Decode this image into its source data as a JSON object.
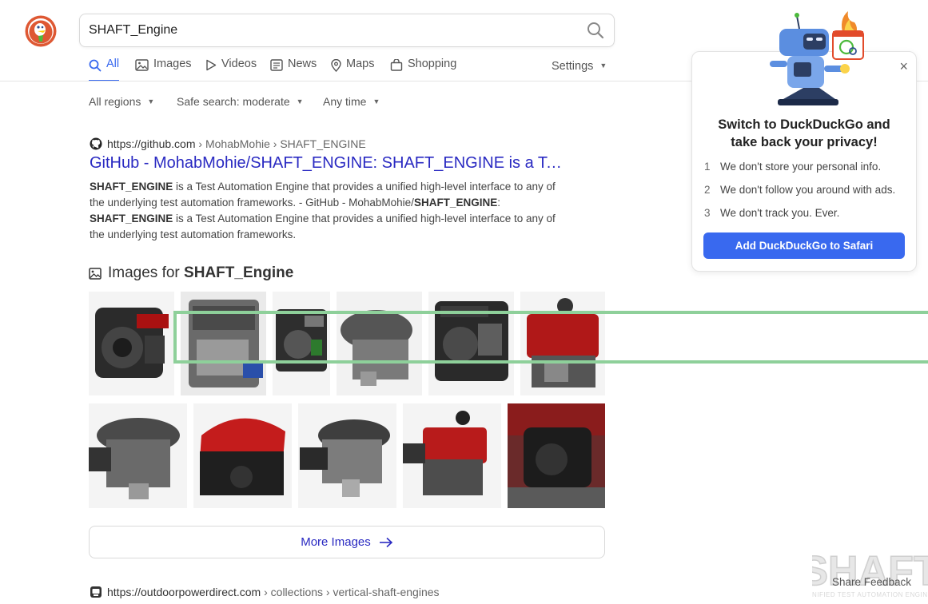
{
  "search": {
    "query": "SHAFT_Engine"
  },
  "nav": {
    "items": [
      {
        "label": "All",
        "icon": "search-icon",
        "active": true
      },
      {
        "label": "Images",
        "icon": "image-icon",
        "active": false
      },
      {
        "label": "Videos",
        "icon": "play-icon",
        "active": false
      },
      {
        "label": "News",
        "icon": "newspaper-icon",
        "active": false
      },
      {
        "label": "Maps",
        "icon": "map-pin-icon",
        "active": false
      },
      {
        "label": "Shopping",
        "icon": "shopping-bag-icon",
        "active": false
      }
    ],
    "settings_label": "Settings"
  },
  "filters": {
    "region": "All regions",
    "safe_search": "Safe search: moderate",
    "time": "Any time"
  },
  "result1": {
    "domain": "https://github.com",
    "path": " › MohabMohie › SHAFT_ENGINE",
    "title": "GitHub - MohabMohie/SHAFT_ENGINE: SHAFT_ENGINE is a Test Automation Engine that provides a unified high-level interface",
    "snippet_bold_1": "SHAFT_ENGINE",
    "snippet_text_1": " is a Test Automation Engine that provides a unified high-level interface to any of the underlying test automation frameworks. - GitHub - MohabMohie/",
    "snippet_bold_2": "SHAFT_ENGINE",
    "snippet_text_2": ":",
    "snippet_bold_3": "SHAFT_ENGINE",
    "snippet_text_3": " is a Test Automation Engine that provides a unified high-level interface to any of the underlying test automation frameworks."
  },
  "images_module": {
    "prefix": "Images for ",
    "query": "SHAFT_Engine",
    "more_label": "More Images"
  },
  "result2": {
    "domain": "https://outdoorpowerdirect.com",
    "path": " › collections › vertical-shaft-engines"
  },
  "promo": {
    "title_line1": "Switch to DuckDuckGo and",
    "title_line2": "take back your privacy!",
    "items": [
      {
        "num": "1",
        "text": "We don't store your personal info."
      },
      {
        "num": "2",
        "text": "We don't follow you around with ads."
      },
      {
        "num": "3",
        "text": "We don't track you. Ever."
      }
    ],
    "button_label": "Add DuckDuckGo to Safari",
    "close_glyph": "×"
  },
  "watermark": {
    "text": "SHAFT",
    "subtext": "UNIFIED TEST AUTOMATION ENGINE"
  },
  "feedback_label": "Share Feedback",
  "colors": {
    "accent": "#3969ef",
    "link": "#2a2ac2",
    "overlay": "#8ed09a",
    "logo": "#de5833"
  }
}
